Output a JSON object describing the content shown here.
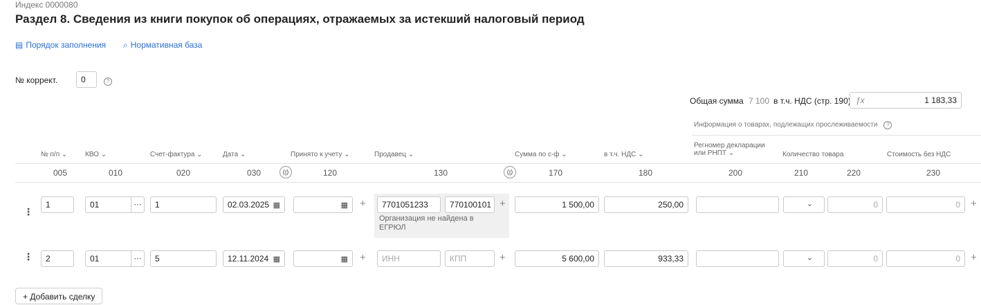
{
  "header": {
    "index": "Индекс 0000080",
    "title": "Раздел 8. Сведения из книги покупок об операциях, отражаемых за истекший налоговый период"
  },
  "links": {
    "fill_order": "Порядок заполнения",
    "normative": "Нормативная база"
  },
  "correction": {
    "label": "№ коррект.",
    "value": "0"
  },
  "totals": {
    "total_label": "Общая сумма",
    "total_value": "7 100",
    "vat_label": "в т.ч. НДС (стр. 190)",
    "fx": "ƒx",
    "vat_value": "1 183,33"
  },
  "tracking_note": "Информация о товарах, подлежащих прослеживаемости",
  "columns": [
    {
      "label": "№ п/п ⌄",
      "code": "005"
    },
    {
      "label": "КВО ⌄",
      "code": "010"
    },
    {
      "label": "Счет-фактура ⌄",
      "code": "020"
    },
    {
      "label": "Дата ⌄",
      "code": "030"
    },
    {
      "label": "Принято к учету ⌄",
      "code": "120"
    },
    {
      "label": "Продавец ⌄",
      "code": "130"
    },
    {
      "label": "Сумма по с-ф ⌄",
      "code": "170"
    },
    {
      "label": "в т.ч. НДС ⌄",
      "code": "180"
    },
    {
      "label": "Регномер декларации\nили РНПТ ⌄",
      "code": "200"
    },
    {
      "label": "Количество товара",
      "code": "210"
    },
    {
      "label": "",
      "code": "220"
    },
    {
      "label": "Стоимость без НДС",
      "code": "230"
    }
  ],
  "rows": [
    {
      "num": "1",
      "kvo": "01",
      "invoice": "1",
      "date": "02.03.2025",
      "accepted": "",
      "inn": "7701051233",
      "kpp": "770100101",
      "seller_note": "Организация не найдена в ЕГРЮЛ",
      "sum": "1 500,00",
      "vat": "250,00",
      "regnum": "",
      "qty_unit": "",
      "qty": "0",
      "cost": "0"
    },
    {
      "num": "2",
      "kvo": "01",
      "invoice": "5",
      "date": "12.11.2024",
      "accepted": "",
      "inn": "",
      "kpp": "",
      "inn_ph": "ИНН",
      "kpp_ph": "КПП",
      "seller_note": "",
      "sum": "5 600,00",
      "vat": "933,33",
      "regnum": "",
      "qty_unit": "",
      "qty": "0",
      "cost": "0"
    }
  ],
  "add_button": "+ Добавить сделку",
  "icons": {
    "ellipsis": "⋯",
    "calendar": "▦",
    "plus": "+",
    "kebab": "⋮",
    "swap": "⟨|⟩",
    "chevron": "⌄",
    "help": "?"
  }
}
